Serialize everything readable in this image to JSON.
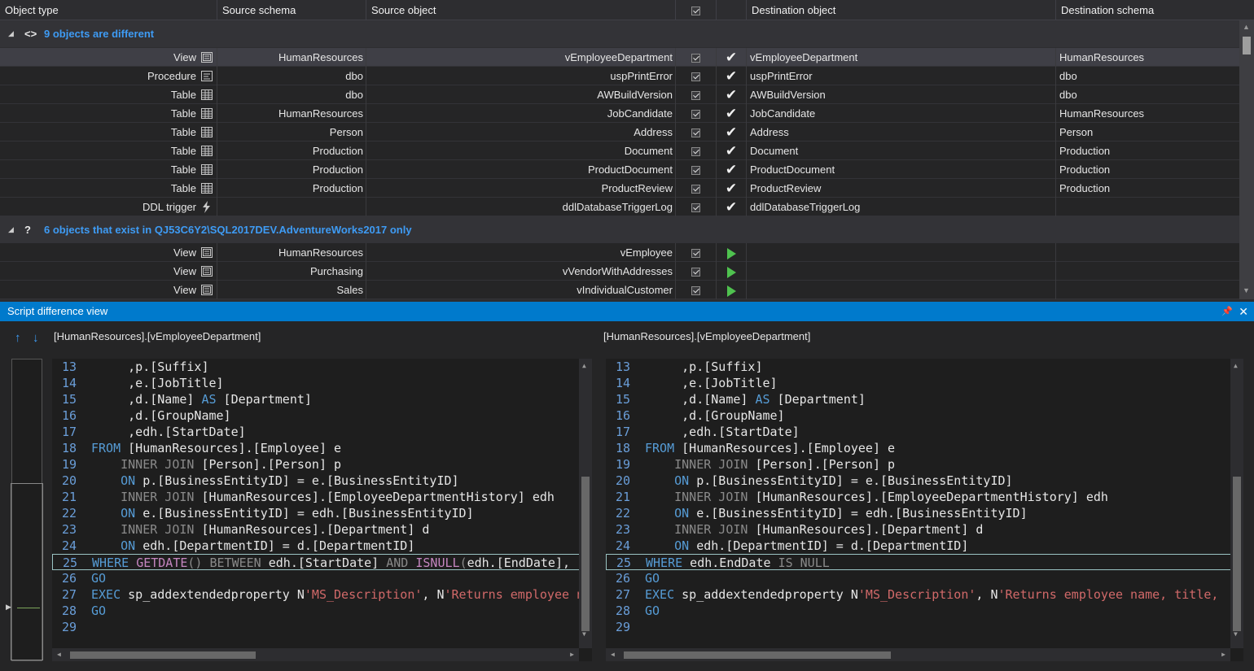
{
  "header": {
    "object_type": "Object type",
    "source_schema": "Source schema",
    "source_object": "Source object",
    "destination_object": "Destination object",
    "destination_schema": "Destination schema"
  },
  "groups": {
    "different": {
      "label": "9 objects are different"
    },
    "source_only": {
      "label": "6 objects that exist in QJ53C6Y2\\SQL2017DEV.AdventureWorks2017 only"
    }
  },
  "rows": [
    {
      "type": "View",
      "icon": "view-icon",
      "src_schema": "HumanResources",
      "src_object": "vEmployeeDepartment",
      "dst_object": "vEmployeeDepartment",
      "dst_schema": "HumanResources",
      "action": "check"
    },
    {
      "type": "Procedure",
      "icon": "procedure-icon",
      "src_schema": "dbo",
      "src_object": "uspPrintError",
      "dst_object": "uspPrintError",
      "dst_schema": "dbo",
      "action": "check"
    },
    {
      "type": "Table",
      "icon": "table-icon",
      "src_schema": "dbo",
      "src_object": "AWBuildVersion",
      "dst_object": "AWBuildVersion",
      "dst_schema": "dbo",
      "action": "check"
    },
    {
      "type": "Table",
      "icon": "table-icon",
      "src_schema": "HumanResources",
      "src_object": "JobCandidate",
      "dst_object": "JobCandidate",
      "dst_schema": "HumanResources",
      "action": "check"
    },
    {
      "type": "Table",
      "icon": "table-icon",
      "src_schema": "Person",
      "src_object": "Address",
      "dst_object": "Address",
      "dst_schema": "Person",
      "action": "check"
    },
    {
      "type": "Table",
      "icon": "table-icon",
      "src_schema": "Production",
      "src_object": "Document",
      "dst_object": "Document",
      "dst_schema": "Production",
      "action": "check"
    },
    {
      "type": "Table",
      "icon": "table-icon",
      "src_schema": "Production",
      "src_object": "ProductDocument",
      "dst_object": "ProductDocument",
      "dst_schema": "Production",
      "action": "check"
    },
    {
      "type": "Table",
      "icon": "table-icon",
      "src_schema": "Production",
      "src_object": "ProductReview",
      "dst_object": "ProductReview",
      "dst_schema": "Production",
      "action": "check"
    },
    {
      "type": "DDL trigger",
      "icon": "lightning-icon",
      "src_schema": "",
      "src_object": "ddlDatabaseTriggerLog",
      "dst_object": "ddlDatabaseTriggerLog",
      "dst_schema": "",
      "action": "check"
    }
  ],
  "rows_only": [
    {
      "type": "View",
      "icon": "view-icon",
      "src_schema": "HumanResources",
      "src_object": "vEmployee",
      "action": "play"
    },
    {
      "type": "View",
      "icon": "view-icon",
      "src_schema": "Purchasing",
      "src_object": "vVendorWithAddresses",
      "action": "play"
    },
    {
      "type": "View",
      "icon": "view-icon",
      "src_schema": "Sales",
      "src_object": "vIndividualCustomer",
      "action": "play"
    }
  ],
  "panel": {
    "title": "Script difference view",
    "left_object": "[HumanResources].[vEmployeeDepartment]",
    "right_object": "[HumanResources].[vEmployeeDepartment]"
  },
  "code_left": [
    [
      13,
      [
        [
          "t",
          "     ,p.[Suffix]"
        ]
      ]
    ],
    [
      14,
      [
        [
          "t",
          "     ,e.[JobTitle]"
        ]
      ]
    ],
    [
      15,
      [
        [
          "t",
          "     ,d.[Name] "
        ],
        [
          "kw",
          "AS"
        ],
        [
          "t",
          " [Department]"
        ]
      ]
    ],
    [
      16,
      [
        [
          "t",
          "     ,d.[GroupName]"
        ]
      ]
    ],
    [
      17,
      [
        [
          "t",
          "     ,edh.[StartDate]"
        ]
      ]
    ],
    [
      18,
      [
        [
          "kw",
          "FROM"
        ],
        [
          "t",
          " [HumanResources].[Employee] e"
        ]
      ]
    ],
    [
      19,
      [
        [
          "t",
          "    "
        ],
        [
          "gk",
          "INNER JOIN"
        ],
        [
          "t",
          " [Person].[Person] p"
        ]
      ]
    ],
    [
      20,
      [
        [
          "t",
          "    "
        ],
        [
          "kw",
          "ON"
        ],
        [
          "t",
          " p.[BusinessEntityID] = e.[BusinessEntityID]"
        ]
      ]
    ],
    [
      21,
      [
        [
          "t",
          "    "
        ],
        [
          "gk",
          "INNER JOIN"
        ],
        [
          "t",
          " [HumanResources].[EmployeeDepartmentHistory] edh"
        ]
      ]
    ],
    [
      22,
      [
        [
          "t",
          "    "
        ],
        [
          "kw",
          "ON"
        ],
        [
          "t",
          " e.[BusinessEntityID] = edh.[BusinessEntityID]"
        ]
      ]
    ],
    [
      23,
      [
        [
          "t",
          "    "
        ],
        [
          "gk",
          "INNER JOIN"
        ],
        [
          "t",
          " [HumanResources].[Department] d"
        ]
      ]
    ],
    [
      24,
      [
        [
          "t",
          "    "
        ],
        [
          "kw",
          "ON"
        ],
        [
          "t",
          " edh.[DepartmentID] = d.[DepartmentID]"
        ]
      ]
    ],
    [
      25,
      [
        [
          "kw",
          "WHERE"
        ],
        [
          "t",
          " "
        ],
        [
          "pu",
          "GETDATE"
        ],
        [
          "gk",
          "()"
        ],
        [
          "t",
          " "
        ],
        [
          "gk",
          "BETWEEN"
        ],
        [
          "t",
          " edh.[StartDate] "
        ],
        [
          "gk",
          "AND"
        ],
        [
          "t",
          " "
        ],
        [
          "pu",
          "ISNULL"
        ],
        [
          "gk",
          "("
        ],
        [
          "t",
          "edh.[EndDate],"
        ]
      ]
    ],
    [
      26,
      [
        [
          "kw",
          "GO"
        ]
      ]
    ],
    [
      27,
      [
        [
          "kw",
          "EXEC"
        ],
        [
          "t",
          " sp_addextendedproperty N"
        ],
        [
          "st",
          "'MS_Description'"
        ],
        [
          "t",
          ", N"
        ],
        [
          "st",
          "'Returns employee name, title,"
        ]
      ]
    ],
    [
      28,
      [
        [
          "kw",
          "GO"
        ]
      ]
    ],
    [
      29,
      [
        [
          "t",
          ""
        ]
      ]
    ]
  ],
  "code_right": [
    [
      13,
      [
        [
          "t",
          "     ,p.[Suffix]"
        ]
      ]
    ],
    [
      14,
      [
        [
          "t",
          "     ,e.[JobTitle]"
        ]
      ]
    ],
    [
      15,
      [
        [
          "t",
          "     ,d.[Name] "
        ],
        [
          "kw",
          "AS"
        ],
        [
          "t",
          " [Department]"
        ]
      ]
    ],
    [
      16,
      [
        [
          "t",
          "     ,d.[GroupName]"
        ]
      ]
    ],
    [
      17,
      [
        [
          "t",
          "     ,edh.[StartDate]"
        ]
      ]
    ],
    [
      18,
      [
        [
          "kw",
          "FROM"
        ],
        [
          "t",
          " [HumanResources].[Employee] e"
        ]
      ]
    ],
    [
      19,
      [
        [
          "t",
          "    "
        ],
        [
          "gk",
          "INNER JOIN"
        ],
        [
          "t",
          " [Person].[Person] p"
        ]
      ]
    ],
    [
      20,
      [
        [
          "t",
          "    "
        ],
        [
          "kw",
          "ON"
        ],
        [
          "t",
          " p.[BusinessEntityID] = e.[BusinessEntityID]"
        ]
      ]
    ],
    [
      21,
      [
        [
          "t",
          "    "
        ],
        [
          "gk",
          "INNER JOIN"
        ],
        [
          "t",
          " [HumanResources].[EmployeeDepartmentHistory] edh"
        ]
      ]
    ],
    [
      22,
      [
        [
          "t",
          "    "
        ],
        [
          "kw",
          "ON"
        ],
        [
          "t",
          " e.[BusinessEntityID] = edh.[BusinessEntityID]"
        ]
      ]
    ],
    [
      23,
      [
        [
          "t",
          "    "
        ],
        [
          "gk",
          "INNER JOIN"
        ],
        [
          "t",
          " [HumanResources].[Department] d"
        ]
      ]
    ],
    [
      24,
      [
        [
          "t",
          "    "
        ],
        [
          "kw",
          "ON"
        ],
        [
          "t",
          " edh.[DepartmentID] = d.[DepartmentID]"
        ]
      ]
    ],
    [
      25,
      [
        [
          "kw",
          "WHERE"
        ],
        [
          "t",
          " edh.EndDate "
        ],
        [
          "gk",
          "IS NULL"
        ]
      ]
    ],
    [
      26,
      [
        [
          "kw",
          "GO"
        ]
      ]
    ],
    [
      27,
      [
        [
          "kw",
          "EXEC"
        ],
        [
          "t",
          " sp_addextendedproperty N"
        ],
        [
          "st",
          "'MS_Description'"
        ],
        [
          "t",
          ", N"
        ],
        [
          "st",
          "'Returns employee name, title,"
        ]
      ]
    ],
    [
      28,
      [
        [
          "kw",
          "GO"
        ]
      ]
    ],
    [
      29,
      [
        [
          "t",
          ""
        ]
      ]
    ]
  ],
  "highlight_line": 25
}
